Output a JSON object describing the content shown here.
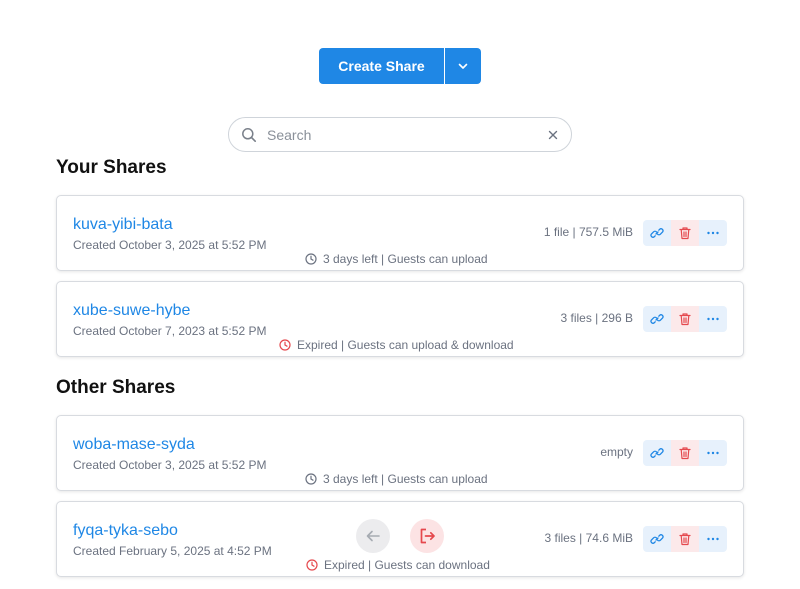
{
  "header": {
    "create_label": "Create Share"
  },
  "search": {
    "placeholder": "Search"
  },
  "sections": {
    "yours_title": "Your Shares",
    "others_title": "Other Shares"
  },
  "your_shares": [
    {
      "name": "kuva-yibi-bata",
      "created": "Created October 3, 2025 at 5:52 PM",
      "meta": "1 file | 757.5 MiB",
      "status": "3 days left | Guests can upload",
      "status_kind": "active"
    },
    {
      "name": "xube-suwe-hybe",
      "created": "Created October 7, 2023 at 5:52 PM",
      "meta": "3 files | 296 B",
      "status": "Expired | Guests can upload & download",
      "status_kind": "expired"
    }
  ],
  "other_shares": [
    {
      "name": "woba-mase-syda",
      "created": "Created October 3, 2025 at 5:52 PM",
      "meta": "empty",
      "status": "3 days left | Guests can upload",
      "status_kind": "active"
    },
    {
      "name": "fyqa-tyka-sebo",
      "created": "Created February 5, 2025 at 4:52 PM",
      "meta": "3 files | 74.6 MiB",
      "status": "Expired | Guests can download",
      "status_kind": "expired"
    }
  ],
  "icons": {
    "dropdown": "chevron-down-icon",
    "search": "search-icon",
    "clear": "close-icon",
    "clock": "clock-icon",
    "link": "link-icon",
    "delete": "trash-icon",
    "more": "more-icon",
    "back": "arrow-left-icon",
    "leave": "logout-icon"
  },
  "colors": {
    "accent": "#1f87e5",
    "danger": "#e5484d",
    "muted": "#6b7280"
  }
}
